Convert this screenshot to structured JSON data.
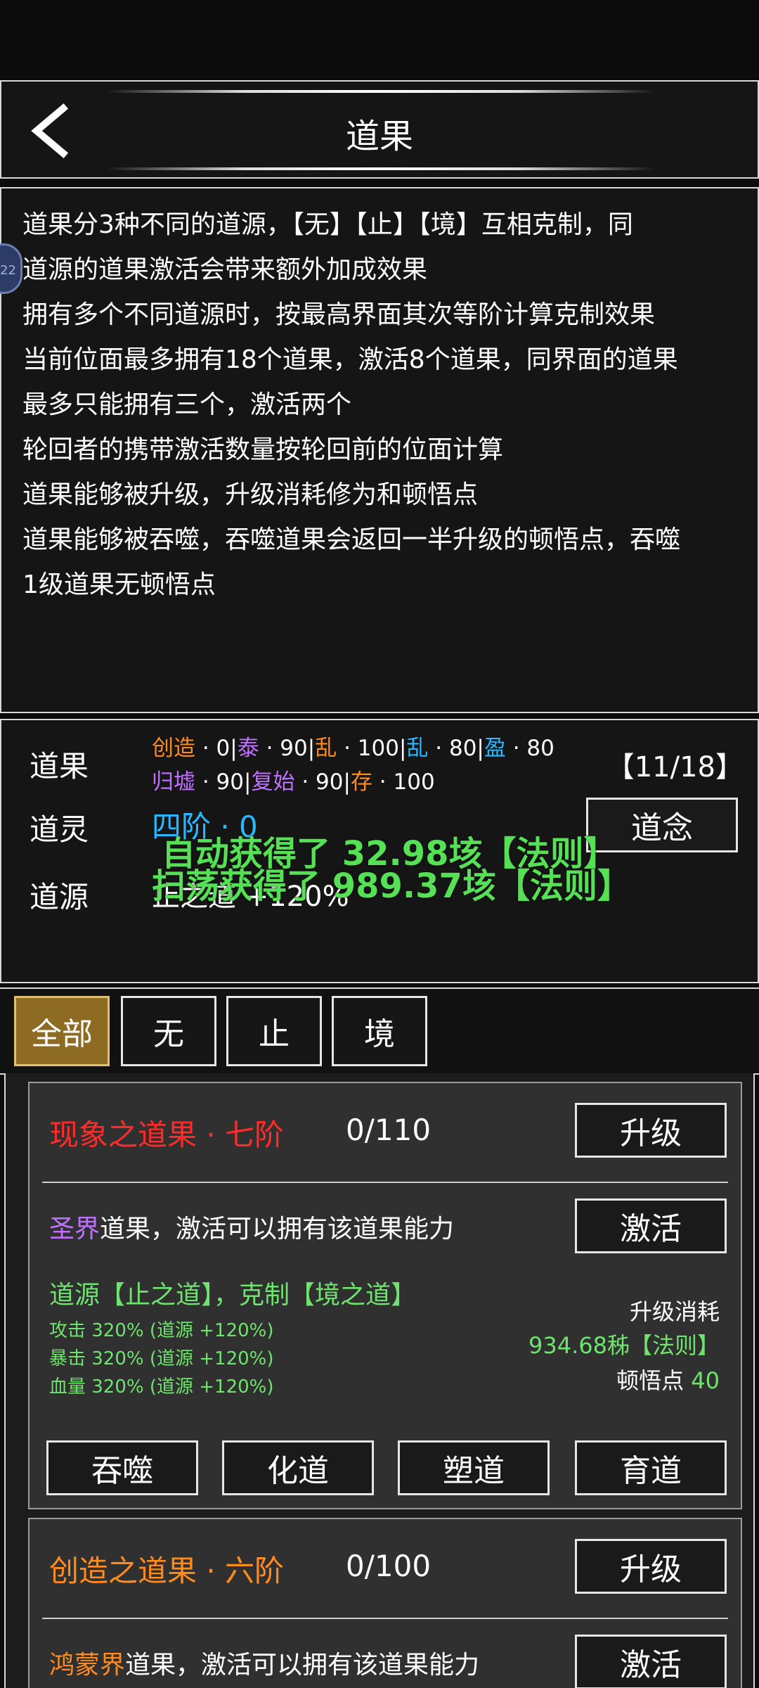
{
  "header": {
    "title": "道果"
  },
  "description": {
    "lines": [
      "道果分3种不同的道源，【无】【止】【境】互相克制，同",
      "道源的道果激活会带来额外加成效果",
      "拥有多个不同道源时，按最高界面其次等阶计算克制效果",
      "当前位面最多拥有18个道果，激活8个道果，同界面的道果",
      "最多只能拥有三个，激活两个",
      "轮回者的携带激活数量按轮回前的位面计算",
      "道果能够被升级，升级消耗修为和顿悟点",
      "道果能够被吞噬，吞噬道果会返回一半升级的顿悟点，吞噬",
      "1级道果无顿悟点"
    ],
    "side_badge": "22"
  },
  "summary": {
    "daoguo_label": "道果",
    "count": "【11/18】",
    "row1": [
      {
        "name": "创造",
        "val": "0",
        "color": "#ff8a1e"
      },
      {
        "name": "泰",
        "val": "90",
        "color": "#c070ff"
      },
      {
        "name": "乱",
        "val": "100",
        "color": "#ff8a1e"
      },
      {
        "name": "乱",
        "val": "80",
        "color": "#28b8ff"
      },
      {
        "name": "盈",
        "val": "80",
        "color": "#28b8ff"
      }
    ],
    "row2": [
      {
        "name": "归墟",
        "val": "90",
        "color": "#c070ff"
      },
      {
        "name": "复始",
        "val": "90",
        "color": "#c070ff"
      },
      {
        "name": "存",
        "val": "100",
        "color": "#ff8a1e"
      }
    ],
    "daoling_label": "道灵",
    "daoling_value": "四阶 · 0",
    "daonian_button": "道念",
    "daoyuan_label": "道源",
    "daoyuan_value": "止之道 +120%",
    "toast1": "自动获得了 32.98垓【法则】",
    "toast2": "扫荡获得了 989.37垓【法则】"
  },
  "tabs": [
    "全部",
    "无",
    "止",
    "境"
  ],
  "cards": [
    {
      "title": "现象之道果 · 七阶",
      "title_color": "#ff2a2a",
      "progress": "0/110",
      "upgrade_button": "升级",
      "type_name": "圣界",
      "type_color": "#c070ff",
      "type_desc": "道果，激活可以拥有该道果能力",
      "activate_button": "激活",
      "daoyuan_text": "道源【止之道】，克制【境之道】",
      "stats": [
        "攻击 320% (道源 +120%)",
        "暴击 320% (道源 +120%)",
        "血量 320% (道源 +120%)"
      ],
      "cost_label": "升级消耗",
      "cost_value": "934.68秭【法则】",
      "dunwu_label": "顿悟点",
      "dunwu_value": "40",
      "actions": [
        "吞噬",
        "化道",
        "塑道",
        "育道"
      ]
    },
    {
      "title": "创造之道果 · 六阶",
      "title_color": "#ff8a1e",
      "progress": "0/100",
      "upgrade_button": "升级",
      "type_name": "鸿蒙界",
      "type_color": "#ff8a1e",
      "type_desc": "道果，激活可以拥有该道果能力",
      "activate_button": "激活"
    }
  ]
}
